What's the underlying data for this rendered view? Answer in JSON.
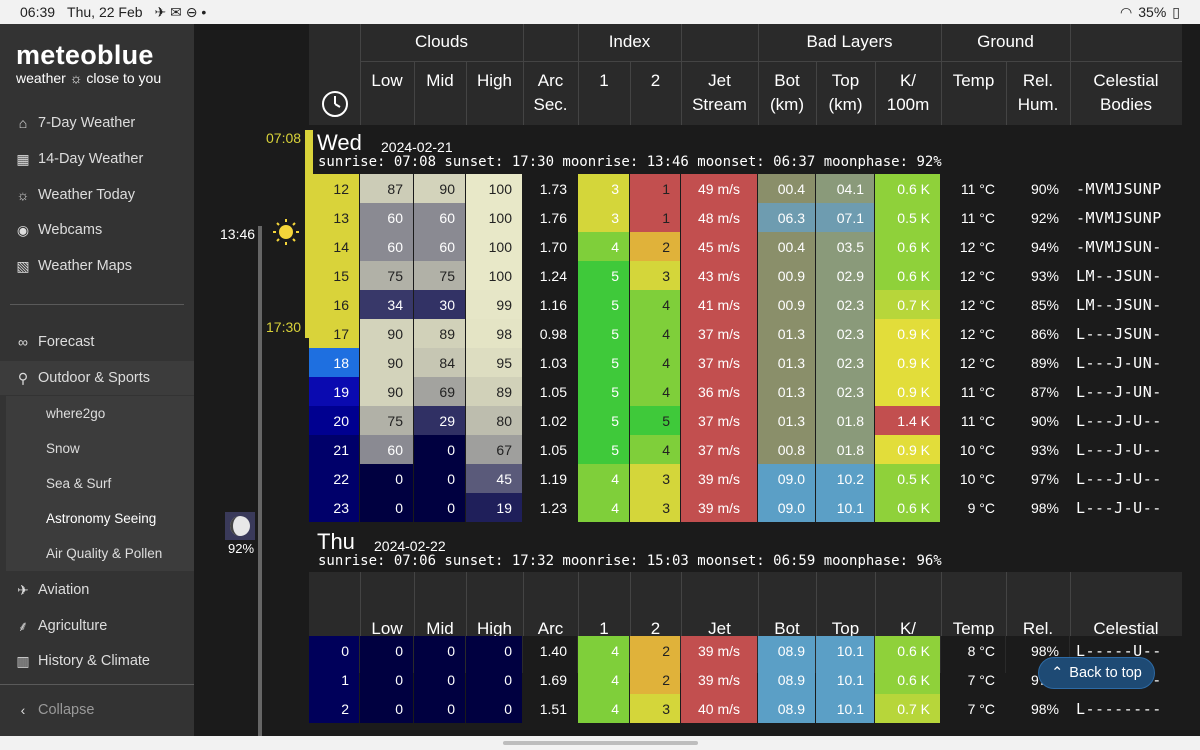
{
  "status_bar": {
    "time": "06:39",
    "date": "Thu, 22 Feb",
    "battery": "35%"
  },
  "logo": {
    "brand": "meteoblue",
    "tagline": "weather ☼ close to you"
  },
  "nav": [
    {
      "label": "7-Day Weather",
      "icon": "house-icon"
    },
    {
      "label": "14-Day Weather",
      "icon": "calendar-icon"
    },
    {
      "label": "Weather Today",
      "icon": "weather-icon"
    },
    {
      "label": "Webcams",
      "icon": "webcam-icon"
    },
    {
      "label": "Weather Maps",
      "icon": "map-icon"
    }
  ],
  "nav2": [
    {
      "label": "Forecast",
      "icon": "binoculars-icon"
    },
    {
      "label": "Outdoor & Sports",
      "icon": "hiker-icon"
    }
  ],
  "subnav": [
    "where2go",
    "Snow",
    "Sea & Surf",
    "Astronomy Seeing",
    "Air Quality & Pollen"
  ],
  "nav3": [
    {
      "label": "Aviation",
      "icon": "plane-icon"
    },
    {
      "label": "Agriculture",
      "icon": "wheat-icon"
    },
    {
      "label": "History & Climate",
      "icon": "chart-icon"
    }
  ],
  "collapse_label": "Collapse",
  "timeline": {
    "sunrise": "07:08",
    "moonrise": "13:46",
    "sunset": "17:30",
    "moonphase": "92%"
  },
  "headers": {
    "groups": [
      "Clouds",
      "Index",
      "Bad Layers",
      "Ground"
    ],
    "cols": [
      {
        "l1": "",
        "l2": "Low"
      },
      {
        "l1": "",
        "l2": "Mid"
      },
      {
        "l1": "",
        "l2": "High"
      },
      {
        "l1": "Arc",
        "l2": "Sec."
      },
      {
        "l1": "",
        "l2": "1"
      },
      {
        "l1": "",
        "l2": "2"
      },
      {
        "l1": "Jet",
        "l2": "Stream"
      },
      {
        "l1": "Bot",
        "l2": "(km)"
      },
      {
        "l1": "Top",
        "l2": "(km)"
      },
      {
        "l1": "K/",
        "l2": "100m"
      },
      {
        "l1": "",
        "l2": "Temp"
      },
      {
        "l1": "Rel.",
        "l2": "Hum."
      },
      {
        "l1": "Celestial",
        "l2": "Bodies"
      }
    ]
  },
  "days": [
    {
      "name": "Wed",
      "date": "2024-02-21",
      "info": "sunrise: 07:08 sunset: 17:30 moonrise: 13:46 moonset: 06:37 moonphase: 92%",
      "rows": [
        {
          "h": "12",
          "low": "87",
          "mid": "90",
          "high": "100",
          "arc": "1.73",
          "i1": "3",
          "i2": "1",
          "jet": "49 m/s",
          "bot": "00.4",
          "top": "04.1",
          "k": "0.6 K",
          "temp": "11 °C",
          "hum": "90%",
          "cel": "-MVMJSUNP"
        },
        {
          "h": "13",
          "low": "60",
          "mid": "60",
          "high": "100",
          "arc": "1.76",
          "i1": "3",
          "i2": "1",
          "jet": "48 m/s",
          "bot": "06.3",
          "top": "07.1",
          "k": "0.5 K",
          "temp": "11 °C",
          "hum": "92%",
          "cel": "-MVMJSUNP"
        },
        {
          "h": "14",
          "low": "60",
          "mid": "60",
          "high": "100",
          "arc": "1.70",
          "i1": "4",
          "i2": "2",
          "jet": "45 m/s",
          "bot": "00.4",
          "top": "03.5",
          "k": "0.6 K",
          "temp": "12 °C",
          "hum": "94%",
          "cel": "-MVMJSUN-"
        },
        {
          "h": "15",
          "low": "75",
          "mid": "75",
          "high": "100",
          "arc": "1.24",
          "i1": "5",
          "i2": "3",
          "jet": "43 m/s",
          "bot": "00.9",
          "top": "02.9",
          "k": "0.6 K",
          "temp": "12 °C",
          "hum": "93%",
          "cel": "LM--JSUN-"
        },
        {
          "h": "16",
          "low": "34",
          "mid": "30",
          "high": "99",
          "arc": "1.16",
          "i1": "5",
          "i2": "4",
          "jet": "41 m/s",
          "bot": "00.9",
          "top": "02.3",
          "k": "0.7 K",
          "temp": "12 °C",
          "hum": "85%",
          "cel": "LM--JSUN-"
        },
        {
          "h": "17",
          "low": "90",
          "mid": "89",
          "high": "98",
          "arc": "0.98",
          "i1": "5",
          "i2": "4",
          "jet": "37 m/s",
          "bot": "01.3",
          "top": "02.3",
          "k": "0.9 K",
          "temp": "12 °C",
          "hum": "86%",
          "cel": "L---JSUN-"
        },
        {
          "h": "18",
          "low": "90",
          "mid": "84",
          "high": "95",
          "arc": "1.03",
          "i1": "5",
          "i2": "4",
          "jet": "37 m/s",
          "bot": "01.3",
          "top": "02.3",
          "k": "0.9 K",
          "temp": "12 °C",
          "hum": "89%",
          "cel": "L---J-UN-"
        },
        {
          "h": "19",
          "low": "90",
          "mid": "69",
          "high": "89",
          "arc": "1.05",
          "i1": "5",
          "i2": "4",
          "jet": "36 m/s",
          "bot": "01.3",
          "top": "02.3",
          "k": "0.9 K",
          "temp": "11 °C",
          "hum": "87%",
          "cel": "L---J-UN-"
        },
        {
          "h": "20",
          "low": "75",
          "mid": "29",
          "high": "80",
          "arc": "1.02",
          "i1": "5",
          "i2": "5",
          "jet": "37 m/s",
          "bot": "01.3",
          "top": "01.8",
          "k": "1.4 K",
          "temp": "11 °C",
          "hum": "90%",
          "cel": "L---J-U--"
        },
        {
          "h": "21",
          "low": "60",
          "mid": "0",
          "high": "67",
          "arc": "1.05",
          "i1": "5",
          "i2": "4",
          "jet": "37 m/s",
          "bot": "00.8",
          "top": "01.8",
          "k": "0.9 K",
          "temp": "10 °C",
          "hum": "93%",
          "cel": "L---J-U--"
        },
        {
          "h": "22",
          "low": "0",
          "mid": "0",
          "high": "45",
          "arc": "1.19",
          "i1": "4",
          "i2": "3",
          "jet": "39 m/s",
          "bot": "09.0",
          "top": "10.2",
          "k": "0.5 K",
          "temp": "10 °C",
          "hum": "97%",
          "cel": "L---J-U--"
        },
        {
          "h": "23",
          "low": "0",
          "mid": "0",
          "high": "19",
          "arc": "1.23",
          "i1": "4",
          "i2": "3",
          "jet": "39 m/s",
          "bot": "09.0",
          "top": "10.1",
          "k": "0.6 K",
          "temp": "9 °C",
          "hum": "98%",
          "cel": "L---J-U--"
        }
      ]
    },
    {
      "name": "Thu",
      "date": "2024-02-22",
      "info": "sunrise: 07:06 sunset: 17:32 moonrise: 15:03 moonset: 06:59 moonphase: 96%",
      "rows": [
        {
          "h": "0",
          "low": "0",
          "mid": "0",
          "high": "0",
          "arc": "1.40",
          "i1": "4",
          "i2": "2",
          "jet": "39 m/s",
          "bot": "08.9",
          "top": "10.1",
          "k": "0.6 K",
          "temp": "8 °C",
          "hum": "98%",
          "cel": "L-----U--"
        },
        {
          "h": "1",
          "low": "0",
          "mid": "0",
          "high": "0",
          "arc": "1.69",
          "i1": "4",
          "i2": "2",
          "jet": "39 m/s",
          "bot": "08.9",
          "top": "10.1",
          "k": "0.6 K",
          "temp": "7 °C",
          "hum": "97%",
          "cel": "L-----U--"
        },
        {
          "h": "2",
          "low": "0",
          "mid": "0",
          "high": "0",
          "arc": "1.51",
          "i1": "4",
          "i2": "3",
          "jet": "40 m/s",
          "bot": "08.9",
          "top": "10.1",
          "k": "0.7 K",
          "temp": "7 °C",
          "hum": "98%",
          "cel": "L--------"
        }
      ]
    }
  ],
  "back_to_top": "Back to top",
  "colors": {
    "sidebar": "#333333",
    "sunlit_hour": "#d9d33a",
    "night_blue": "#00005a",
    "jet_red": "#c24f4f",
    "index_green": "#3fc93a",
    "k_lime": "#8fd13a"
  }
}
